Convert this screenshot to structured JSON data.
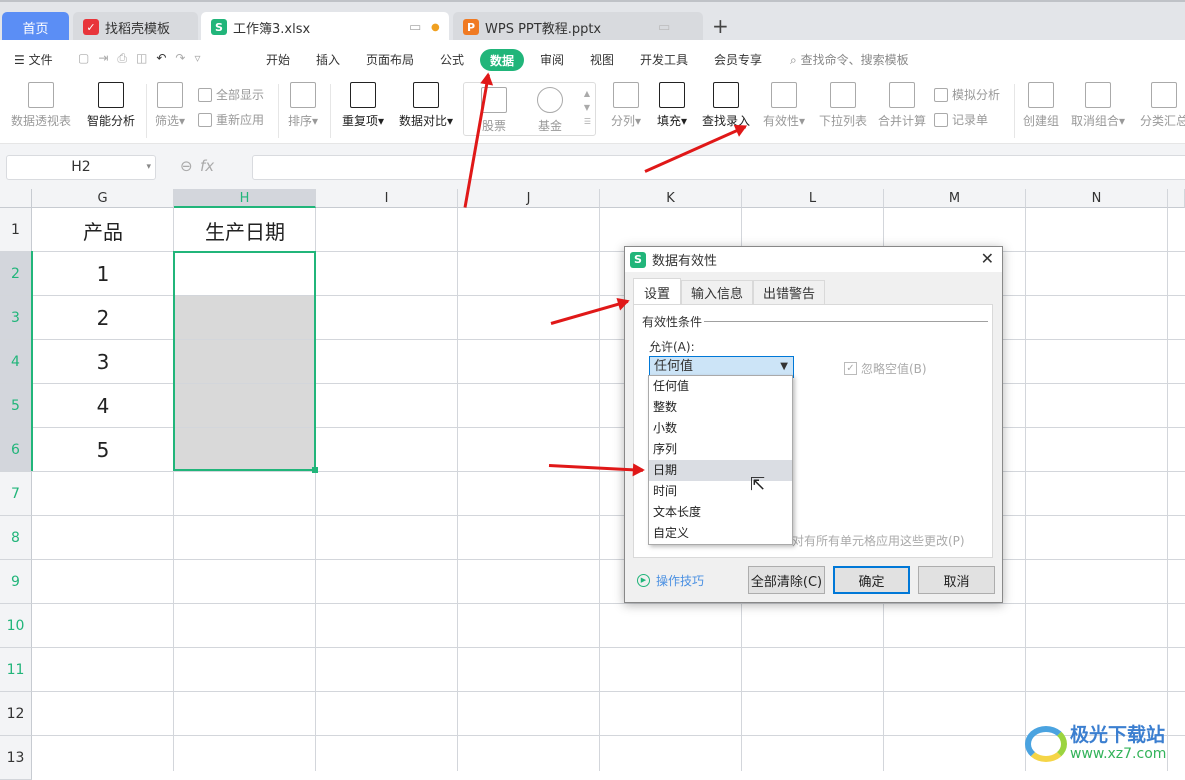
{
  "tabs": [
    {
      "label": "首页",
      "active": false
    },
    {
      "label": "找稻壳模板",
      "icon": "docer-icon"
    },
    {
      "label": "工作簿3.xlsx",
      "icon": "sheet-icon",
      "active": true
    },
    {
      "label": "WPS PPT教程.pptx",
      "icon": "ppt-icon"
    }
  ],
  "menu": {
    "file": "文件",
    "items": [
      "开始",
      "插入",
      "页面布局",
      "公式",
      "数据",
      "审阅",
      "视图",
      "开发工具",
      "会员专享"
    ],
    "active": "数据",
    "search_placeholder": "查找命令、搜索模板"
  },
  "ribbon": {
    "pivot": "数据透视表",
    "smart": "智能分析",
    "filter": "筛选",
    "show_all": "全部显示",
    "reapply": "重新应用",
    "sort": "排序",
    "duplicates": "重复项",
    "compare": "数据对比",
    "stock": "股票",
    "fund": "基金",
    "split": "分列",
    "fill": "填充",
    "lookup": "查找录入",
    "validity": "有效性",
    "dropdown": "下拉列表",
    "consolidate": "合并计算",
    "whatif": "模拟分析",
    "record": "记录单",
    "group": "创建组",
    "ungroup": "取消组合",
    "subtotal": "分类汇总"
  },
  "formula_bar": {
    "name_box": "H2",
    "fx": "fx",
    "value": ""
  },
  "sheet": {
    "columns": [
      "G",
      "H",
      "I",
      "J",
      "K",
      "L",
      "M",
      "N"
    ],
    "selected_column": "H",
    "rows": [
      "1",
      "2",
      "3",
      "4",
      "5",
      "6",
      "7",
      "8",
      "9",
      "10",
      "11",
      "12",
      "13"
    ],
    "cells": {
      "G1": "产品",
      "H1": "生产日期",
      "G2": "1",
      "G3": "2",
      "G4": "3",
      "G5": "4",
      "G6": "5"
    },
    "selection": "H2:H6"
  },
  "dialog": {
    "title": "数据有效性",
    "tabs": [
      "设置",
      "输入信息",
      "出错警告"
    ],
    "active_tab": "设置",
    "group_label": "有效性条件",
    "allow_label": "允许(A):",
    "allow_value": "任何值",
    "ignore_blank": "忽略空值(B)",
    "apply_all": "对有所有单元格应用这些更改(P)",
    "options": [
      "任何值",
      "整数",
      "小数",
      "序列",
      "日期",
      "时间",
      "文本长度",
      "自定义"
    ],
    "hovered_option": "日期",
    "tips": "操作技巧",
    "clear_all": "全部清除(C)",
    "ok": "确定",
    "cancel": "取消"
  },
  "watermark": {
    "name": "极光下载站",
    "url": "www.xz7.com"
  },
  "colors": {
    "accent": "#21b57a",
    "home_tab": "#5b8ef5",
    "arrow": "#e01818"
  }
}
